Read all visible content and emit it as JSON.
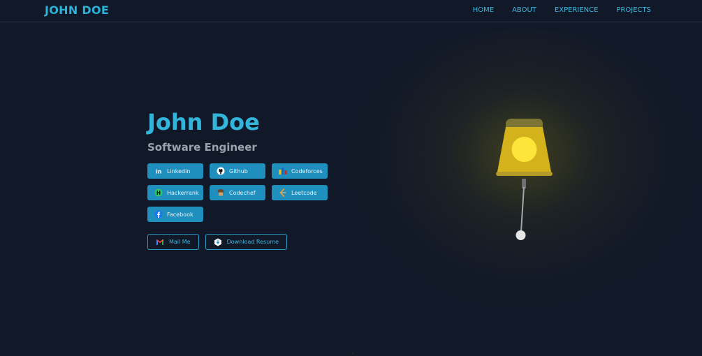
{
  "navbar": {
    "brand": "JOHN DOE",
    "links": [
      {
        "label": "HOME"
      },
      {
        "label": "ABOUT"
      },
      {
        "label": "EXPERIENCE"
      },
      {
        "label": "PROJECTS"
      }
    ]
  },
  "hero": {
    "name": "John Doe",
    "role": "Software Engineer"
  },
  "socials": [
    {
      "label": "Linkedin",
      "icon": "linkedin-icon"
    },
    {
      "label": "Github",
      "icon": "github-icon"
    },
    {
      "label": "Codeforces",
      "icon": "codeforces-icon"
    },
    {
      "label": "Hackerrank",
      "icon": "hackerrank-icon"
    },
    {
      "label": "Codechef",
      "icon": "codechef-icon"
    },
    {
      "label": "Leetcode",
      "icon": "leetcode-icon"
    },
    {
      "label": "Facebook",
      "icon": "facebook-icon"
    }
  ],
  "cta": {
    "mail_label": "Mail Me",
    "resume_label": "Download Resume"
  },
  "colors": {
    "background": "#111827",
    "accent": "#33b5db",
    "button": "#1f8fbd",
    "lamp_shade": "#d4b21c",
    "lamp_bulb": "#fde53a"
  }
}
